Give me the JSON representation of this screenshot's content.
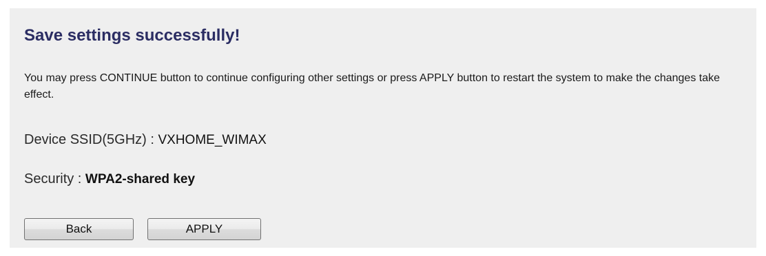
{
  "page": {
    "title": "Save settings successfully!",
    "message": "You may press CONTINUE button to continue configuring other settings or press APPLY button to restart the system to make the changes take effect."
  },
  "details": {
    "ssid_label": "Device SSID(5GHz) : ",
    "ssid_value": "VXHOME_WIMAX",
    "security_label": "Security : ",
    "security_value": "WPA2-shared key"
  },
  "buttons": {
    "back_label": "Back",
    "apply_label": "APPLY"
  },
  "colors": {
    "panel_background": "#efefef",
    "title_color": "#2b2d63"
  }
}
